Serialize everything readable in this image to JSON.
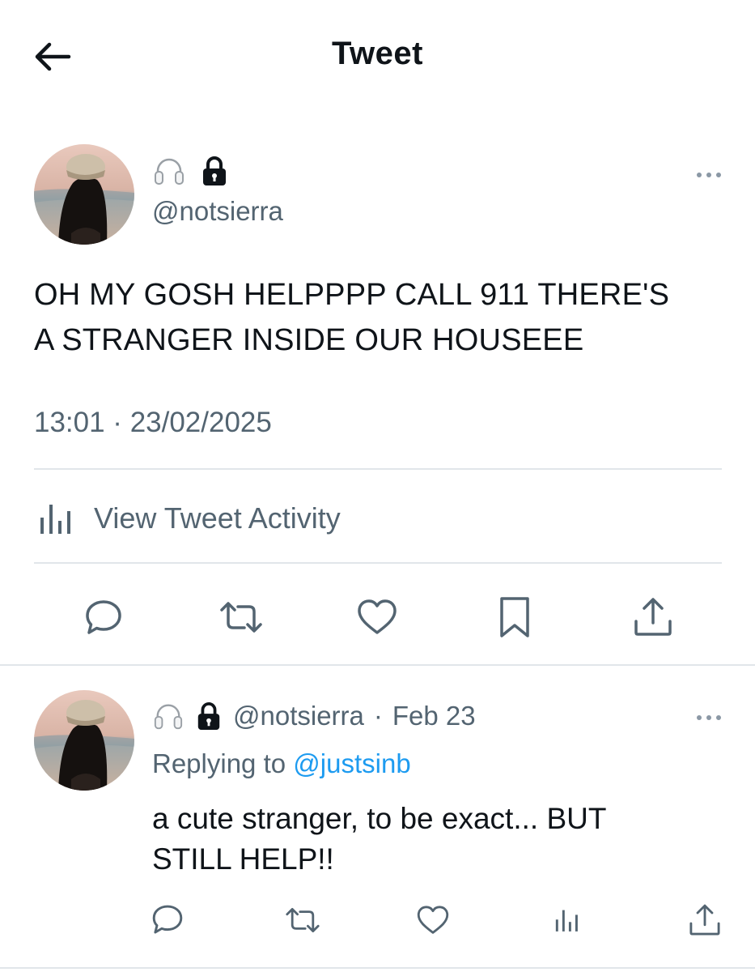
{
  "header": {
    "title": "Tweet"
  },
  "tweet": {
    "handle": "@notsierra",
    "badges": [
      "headphones-icon",
      "lock-icon"
    ],
    "text_line1": "OH MY GOSH HELPPPP CALL 911 THERE'S",
    "text_line2": "A STRANGER INSIDE OUR HOUSEEE",
    "timestamp": "13:01 · 23/02/2025",
    "activity_label": "View Tweet Activity"
  },
  "actions": [
    "reply-icon",
    "retweet-icon",
    "like-icon",
    "bookmark-icon",
    "share-icon"
  ],
  "reply": {
    "handle": "@notsierra",
    "separator": "·",
    "date": "Feb 23",
    "replying_prefix": "Replying to",
    "replying_to": "@justsinb",
    "text_line1": "a cute stranger, to be exact... BUT",
    "text_line2": "STILL HELP!!",
    "actions": [
      "reply-icon",
      "retweet-icon",
      "like-icon",
      "analytics-icon",
      "share-icon"
    ]
  },
  "colors": {
    "text": "#0f1419",
    "secondary": "#536471",
    "link": "#1d9bf0",
    "divider": "#e1e6ea"
  }
}
